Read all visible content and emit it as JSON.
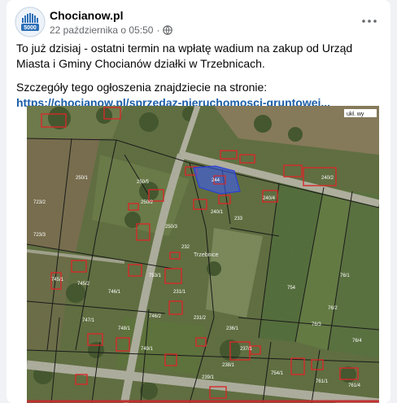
{
  "post": {
    "author": "Chocianow.pl",
    "timestamp": "22 października o 05:50",
    "separator": "·",
    "privacy_icon": "globe-icon",
    "more_icon": "more-horizontal-icon",
    "paragraph1": "To już dzisiaj - ostatni termin na wpłatę wadium na zakup od Urząd Miasta i Gminy Chocianów działki w Trzebnicach.",
    "paragraph2_prefix": "Szczegóły tego ogłoszenia znajdziecie na stronie: ",
    "link_text": "https://chocianow.pl/sprzedaz-nieruchomosci-gruntowej..."
  },
  "avatar": {
    "badge_text": "5000"
  },
  "map": {
    "labels": {
      "ukl": "ukł. wy",
      "p2501": "250/1",
      "p2502": "250/2",
      "p2503": "250/3",
      "p2505": "250/5",
      "p2402": "240/2",
      "p2401": "240/1",
      "p2404": "240/4",
      "p7601": "76/1",
      "p7602": "76/2",
      "p7603": "76/3",
      "p7604": "76/4",
      "p754": "754",
      "p7451": "745/1",
      "p7452": "745/2",
      "p7461": "746/1",
      "p7462": "746/2",
      "p7471": "747/1",
      "p7481": "748/1",
      "p7491": "749/1",
      "p233": "233",
      "p232": "232",
      "p2311": "231/1",
      "p2312": "231/2",
      "p2361": "236/1",
      "p2371": "237/1",
      "p2381": "238/1",
      "p2391": "239/1",
      "p7232": "723/2",
      "p7233": "723/3",
      "p7531": "753/1",
      "p7541": "754/1",
      "p7611": "761/1",
      "p7614": "761/4",
      "road": "Trzebnice",
      "highlight": "244"
    }
  },
  "colors": {
    "link": "#1b5ea8",
    "parcel_outline": "#d42a2a",
    "highlight": "#3a5cff",
    "bottom_line": "#c03030"
  }
}
